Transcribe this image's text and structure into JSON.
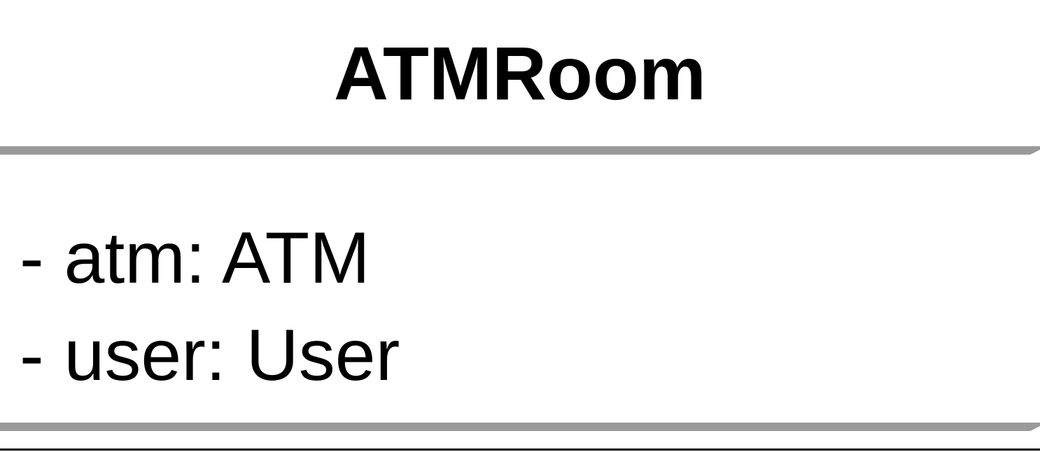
{
  "class": {
    "name": "ATMRoom",
    "attributes": [
      "- atm: ATM",
      "- user: User"
    ]
  },
  "colors": {
    "text": "#000000",
    "divider": "#9a9a9a",
    "background": "#ffffff"
  }
}
